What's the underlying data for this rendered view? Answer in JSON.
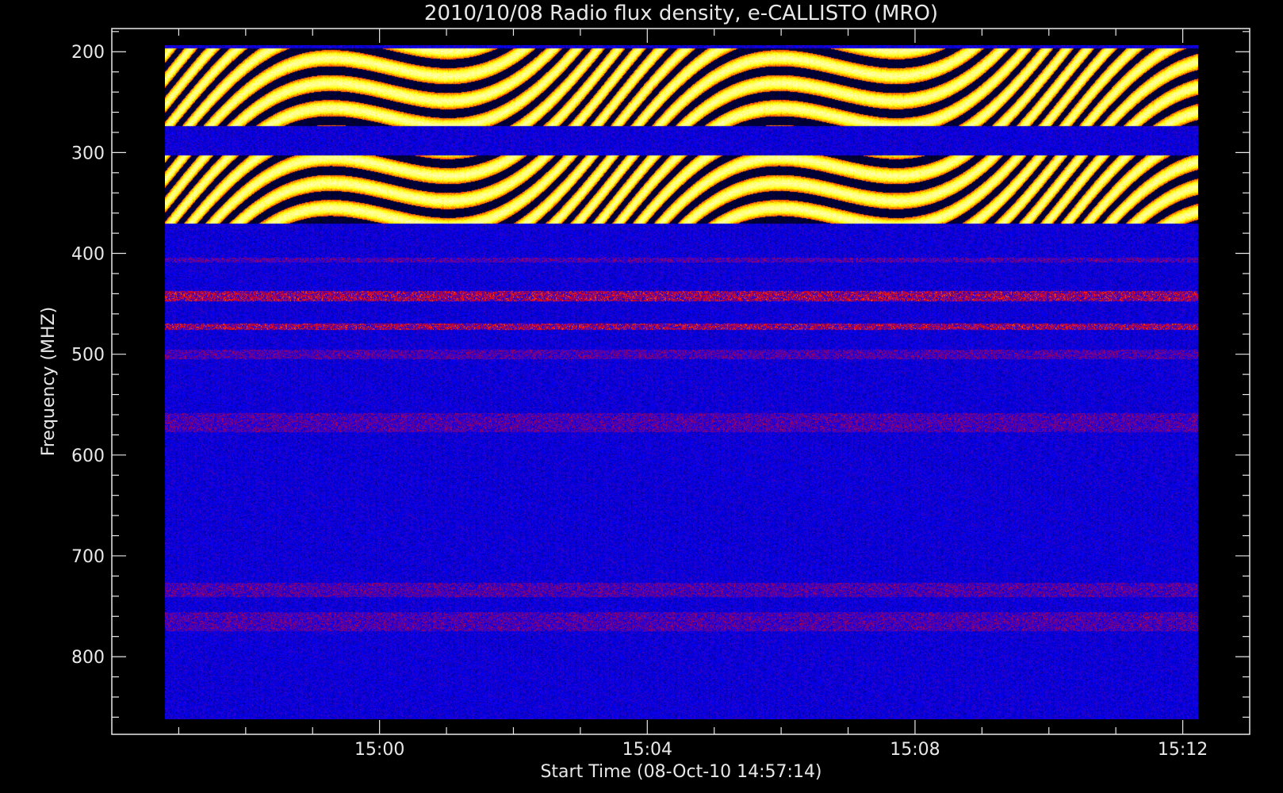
{
  "chart_data": {
    "type": "heatmap",
    "title": "2010/10/08  Radio flux density, e-CALLISTO (MRO)",
    "xlabel": "Start Time (08-Oct-10 14:57:14)",
    "ylabel": "Frequency (MHZ)",
    "x_start": "14:57:14",
    "x_end": "15:12:30",
    "xlim": [
      "14:56",
      "15:13"
    ],
    "ylim": [
      177,
      877
    ],
    "y_inverted": true,
    "x_major_ticks": [
      "15:00",
      "15:04",
      "15:08",
      "15:12"
    ],
    "x_minor_step_minutes": 1,
    "y_major_ticks": [
      200,
      300,
      400,
      500,
      600,
      700,
      800
    ],
    "y_minor_step": 20,
    "data_frequency_range_mhz": [
      177,
      870
    ],
    "colormap": [
      "#000000",
      "#0000ff",
      "#ff0000",
      "#ffff00",
      "#ffffff"
    ],
    "background": "#000000",
    "emission_bands_mhz": [
      {
        "from": 180,
        "to": 260,
        "level": "high",
        "modulated": true
      },
      {
        "from": 290,
        "to": 360,
        "level": "high",
        "modulated": true
      },
      {
        "from": 395,
        "to": 400,
        "level": "low"
      },
      {
        "from": 430,
        "to": 440,
        "level": "medium"
      },
      {
        "from": 463,
        "to": 470,
        "level": "medium"
      },
      {
        "from": 490,
        "to": 500,
        "level": "low"
      },
      {
        "from": 555,
        "to": 575,
        "level": "low"
      },
      {
        "from": 730,
        "to": 745,
        "level": "low"
      },
      {
        "from": 760,
        "to": 780,
        "level": "low"
      }
    ]
  }
}
